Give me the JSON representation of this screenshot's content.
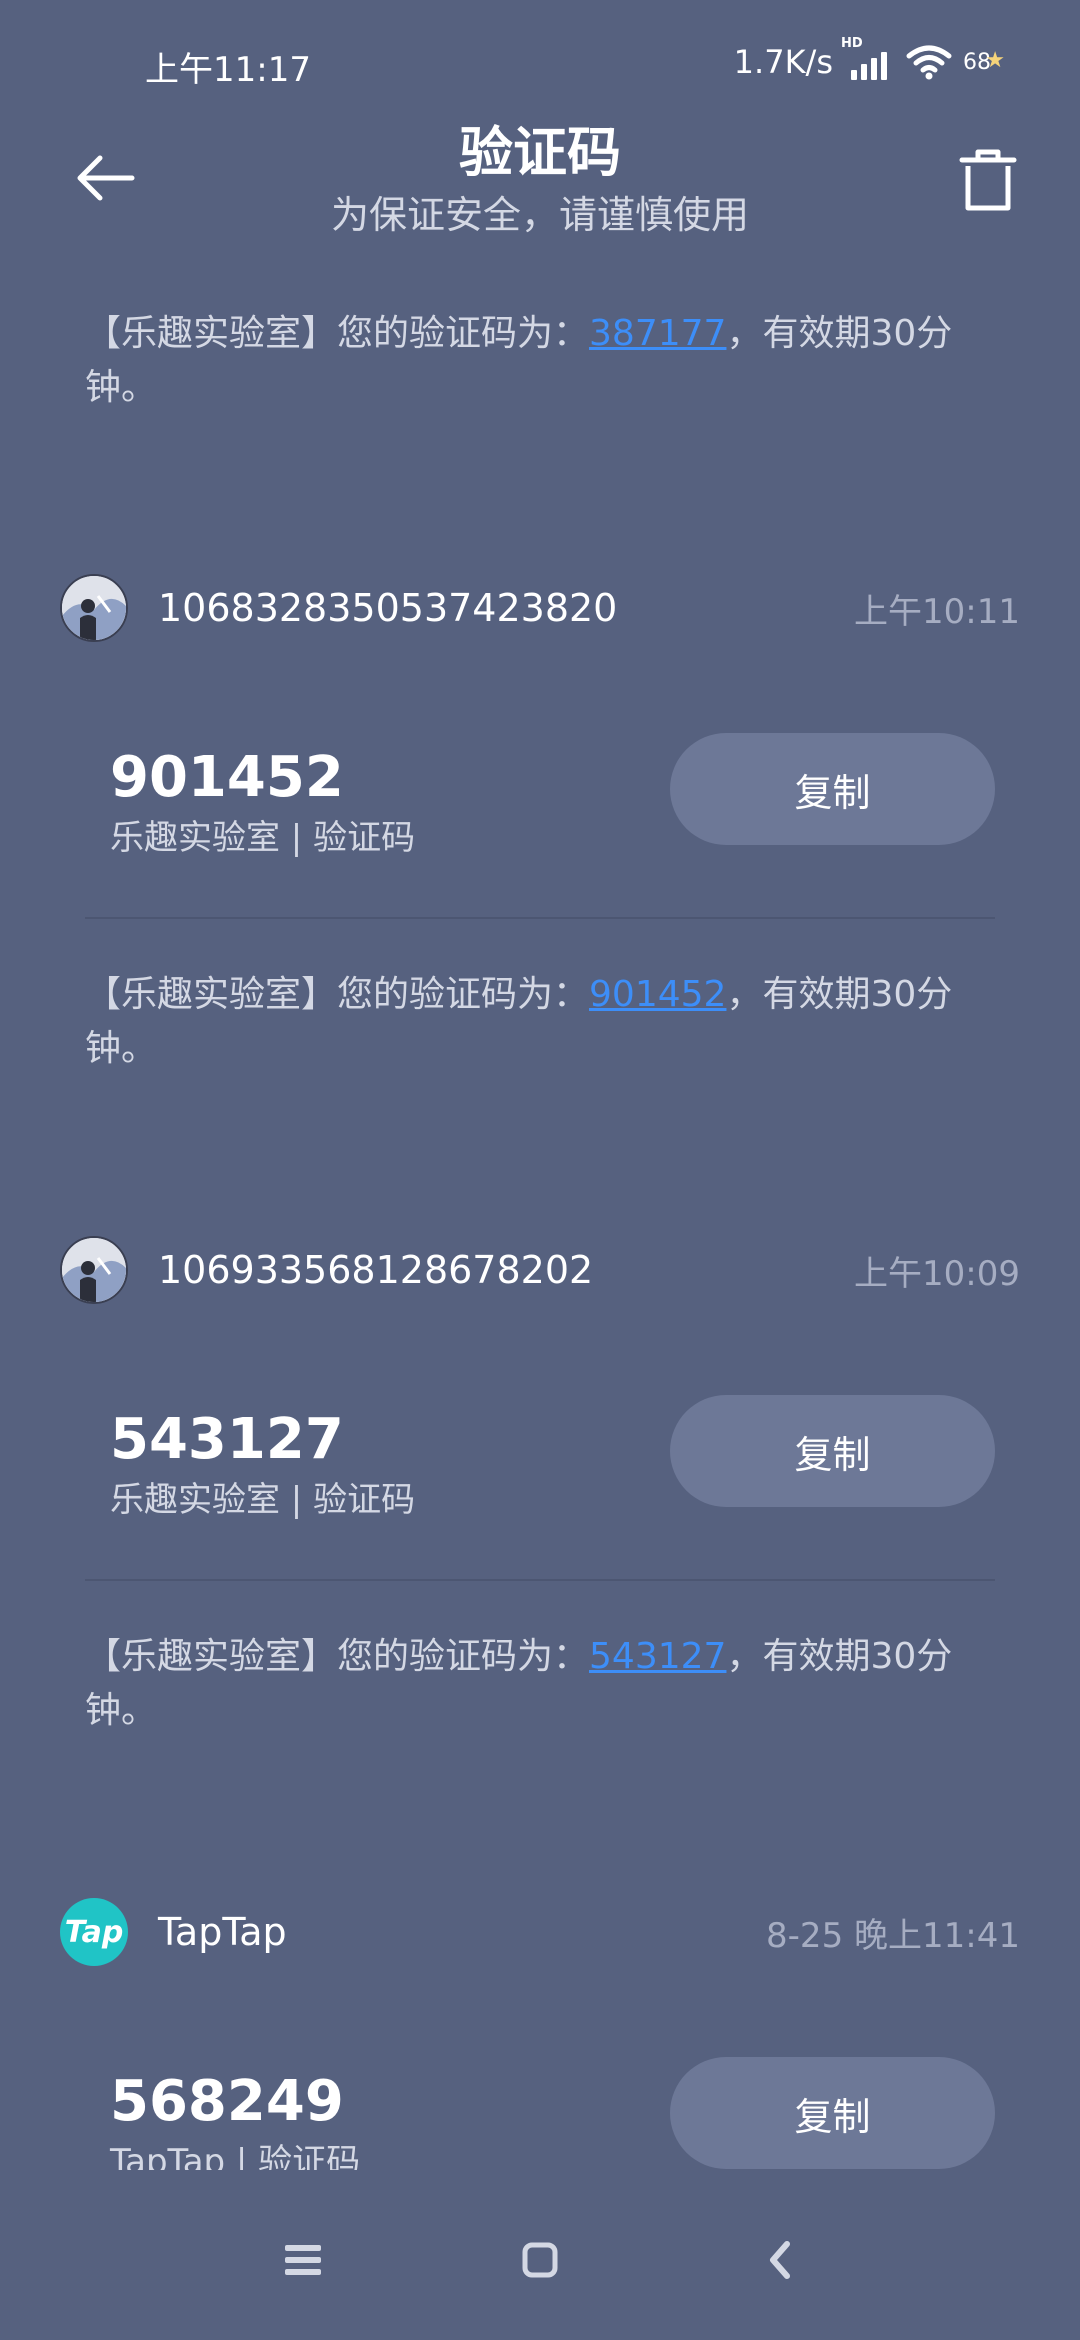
{
  "status_bar": {
    "time": "上午11:17",
    "net_speed": "1.7K/s",
    "hd_label": "HD",
    "battery": "68"
  },
  "header": {
    "title": "验证码",
    "subtitle": "为保证安全，请谨慎使用"
  },
  "top_message": {
    "prefix": "【乐趣实验室】您的验证码为：",
    "code": "387177",
    "suffix": "，有效期30分钟。"
  },
  "messages": [
    {
      "sender": "1068328350537423820",
      "time": "上午10:11",
      "code": "901452",
      "source": "乐趣实验室 | 验证码",
      "copy_label": "复制",
      "text_prefix": "【乐趣实验室】您的验证码为：",
      "text_code": "901452",
      "text_suffix": "，有效期30分钟。"
    },
    {
      "sender": "106933568128678202",
      "time": "上午10:09",
      "code": "543127",
      "source": "乐趣实验室 | 验证码",
      "copy_label": "复制",
      "text_prefix": "【乐趣实验室】您的验证码为：",
      "text_code": "543127",
      "text_suffix": "，有效期30分钟。"
    },
    {
      "sender": "TapTap",
      "avatar_label": "Tap",
      "time": "8-25 晚上11:41",
      "code": "568249",
      "source": "TapTap | 验证码",
      "copy_label": "复制"
    }
  ],
  "icons": {
    "back": "arrow-left-icon",
    "delete": "trash-icon",
    "nav_menu": "menu-icon",
    "nav_home": "home-icon",
    "nav_back": "chevron-left-icon"
  },
  "colors": {
    "background": "#56617f",
    "link": "#3d8ef8",
    "button": "#6d7897",
    "tap_brand": "#20c4c6"
  }
}
